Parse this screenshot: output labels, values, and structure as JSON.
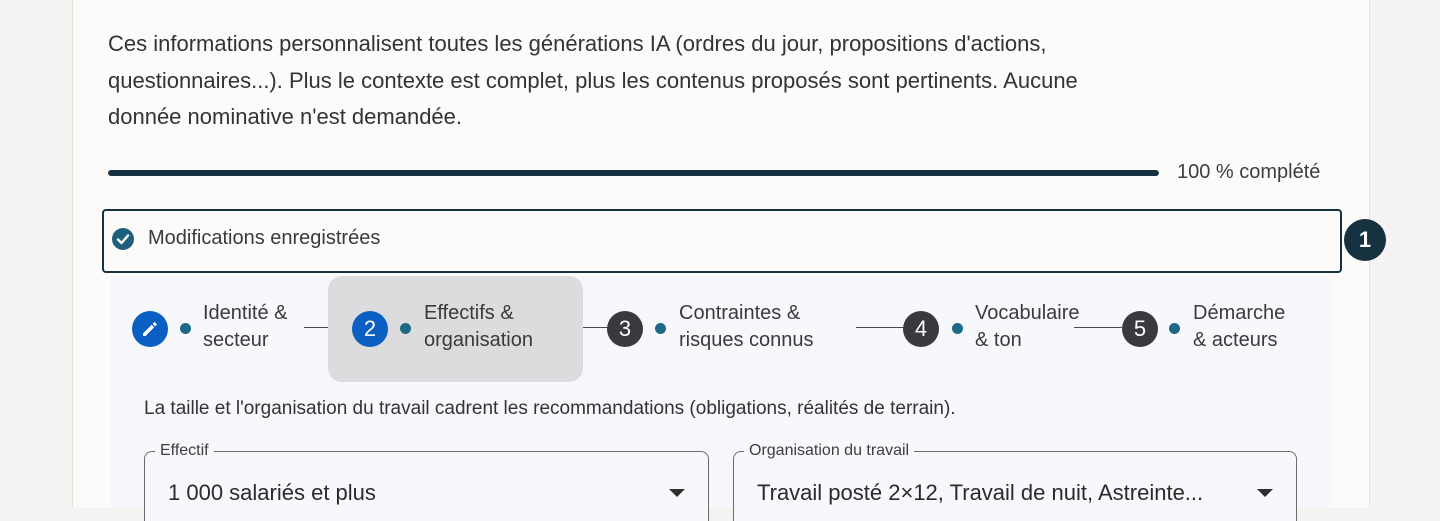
{
  "intro": {
    "text": "Ces informations personnalisent toutes les générations IA (ordres du jour, propositions d'actions, questionnaires...). Plus le contexte est complet, plus les contenus proposés sont pertinents. Aucune donnée nominative n'est demandée."
  },
  "progress": {
    "percent": 100,
    "label": "100 % complété"
  },
  "save_status": {
    "label": "Modifications enregistrées"
  },
  "marker": {
    "label": "1"
  },
  "stepper": {
    "steps": [
      {
        "number": "",
        "line1": "Identité &",
        "line2": "secteur",
        "state": "done-edit"
      },
      {
        "number": "2",
        "line1": "Effectifs &",
        "line2": "organisation",
        "state": "active"
      },
      {
        "number": "3",
        "line1": "Contraintes &",
        "line2": "risques connus",
        "state": "pending"
      },
      {
        "number": "4",
        "line1": "Vocabulaire",
        "line2": "& ton",
        "state": "pending"
      },
      {
        "number": "5",
        "line1": "Démarche",
        "line2": "& acteurs",
        "state": "pending"
      }
    ]
  },
  "panel": {
    "description": "La taille et l'organisation du travail cadrent les recommandations (obligations, réalités de terrain).",
    "fields": {
      "effectif": {
        "label": "Effectif",
        "value": "1 000 salariés et plus"
      },
      "organisation": {
        "label": "Organisation du travail",
        "value": "Travail posté 2×12, Travail de nuit, Astreinte..."
      }
    }
  },
  "colors": {
    "accent_dark": "#16313f",
    "step_blue": "#0b5fc2",
    "step_dark": "#3a3a3e",
    "dot": "#1e6a86"
  }
}
